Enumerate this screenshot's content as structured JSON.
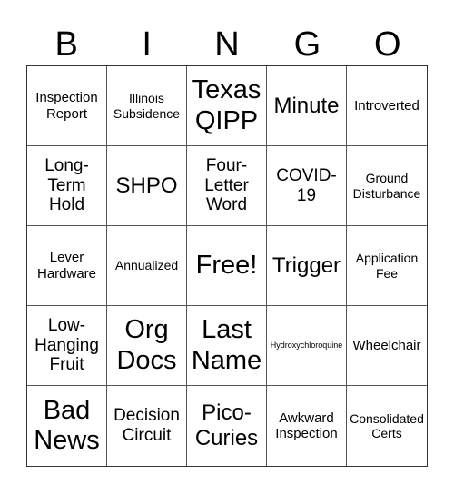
{
  "header": {
    "letters": [
      "B",
      "I",
      "N",
      "G",
      "O"
    ]
  },
  "cells": [
    {
      "text": "Inspection\nReport",
      "size": "s-md"
    },
    {
      "text": "Illinois\nSubsidence",
      "size": "s-sm"
    },
    {
      "text": "Texas\nQIPP",
      "size": "s-xxl"
    },
    {
      "text": "Minute",
      "size": "s-xl"
    },
    {
      "text": "Introverted",
      "size": "s-md"
    },
    {
      "text": "Long-\nTerm\nHold",
      "size": "s-lg"
    },
    {
      "text": "SHPO",
      "size": "s-xl"
    },
    {
      "text": "Four-\nLetter\nWord",
      "size": "s-lg"
    },
    {
      "text": "COVID-\n19",
      "size": "s-lg"
    },
    {
      "text": "Ground\nDisturbance",
      "size": "s-sm"
    },
    {
      "text": "Lever\nHardware",
      "size": "s-md"
    },
    {
      "text": "Annualized",
      "size": "s-sm"
    },
    {
      "text": "Free!",
      "size": "s-xxl"
    },
    {
      "text": "Trigger",
      "size": "s-xl"
    },
    {
      "text": "Application\nFee",
      "size": "s-sm"
    },
    {
      "text": "Low-\nHanging\nFruit",
      "size": "s-lg"
    },
    {
      "text": "Org\nDocs",
      "size": "s-xxl"
    },
    {
      "text": "Last\nName",
      "size": "s-xxl"
    },
    {
      "text": "Hydroxychloroquine",
      "size": "s-xs"
    },
    {
      "text": "Wheelchair",
      "size": "s-md"
    },
    {
      "text": "Bad\nNews",
      "size": "s-xxl"
    },
    {
      "text": "Decision\nCircuit",
      "size": "s-lg"
    },
    {
      "text": "Pico-\nCuries",
      "size": "s-xl"
    },
    {
      "text": "Awkward\nInspection",
      "size": "s-md"
    },
    {
      "text": "Consolidated\nCerts",
      "size": "s-sm"
    }
  ]
}
